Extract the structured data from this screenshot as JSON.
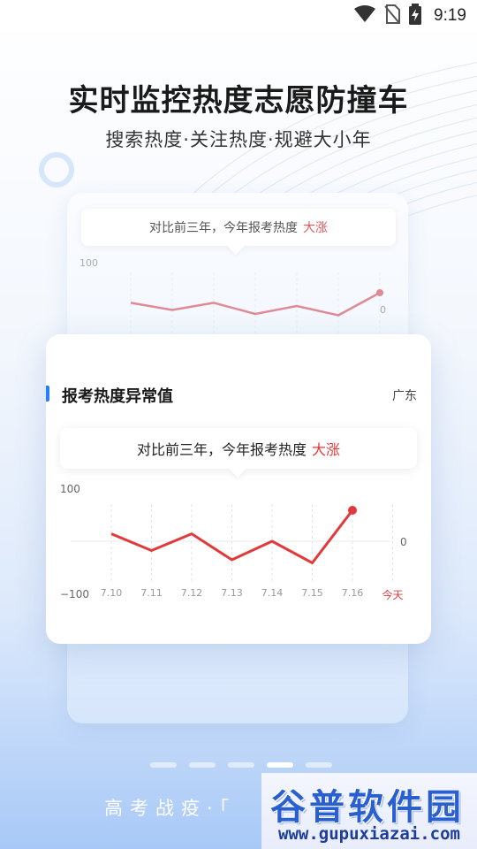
{
  "status_bar": {
    "time": "9:19",
    "icons": [
      "wifi-icon",
      "no-sim-icon",
      "battery-charging-icon"
    ]
  },
  "hero": {
    "title": "实时监控热度志愿防撞车",
    "subtitle": "搜索热度·关注热度·规避大小年"
  },
  "back_card": {
    "bubble_text": "对比前三年，今年报考热度",
    "bubble_highlight": "大涨",
    "axis_top": "100",
    "axis_zero": "0"
  },
  "front_card": {
    "title": "报考热度异常值",
    "region": "广东",
    "bubble_text": "对比前三年，今年报考热度",
    "bubble_highlight": "大涨",
    "axis_top": "100",
    "axis_zero": "0",
    "axis_bottom": "−100"
  },
  "chart_data": {
    "type": "line",
    "categories": [
      "7.10",
      "7.11",
      "7.12",
      "7.13",
      "7.14",
      "7.15",
      "7.16",
      "今天"
    ],
    "series": [
      {
        "values": [
          12,
          -15,
          12,
          -30,
          0,
          -35,
          50
        ]
      }
    ],
    "ylim": [
      -100,
      100
    ],
    "line_color": "#e23a3a",
    "back_line_color": "#e08a95",
    "grid": "vertical-dashed"
  },
  "pagination": {
    "count": 5,
    "active_index": 3
  },
  "bottom_caption": "高考战疫·「",
  "watermark": {
    "title": "谷普软件园",
    "url": "www.gupuxiazai.com"
  },
  "colors": {
    "accent": "#2a7ef5",
    "highlight": "#e23a3a"
  }
}
